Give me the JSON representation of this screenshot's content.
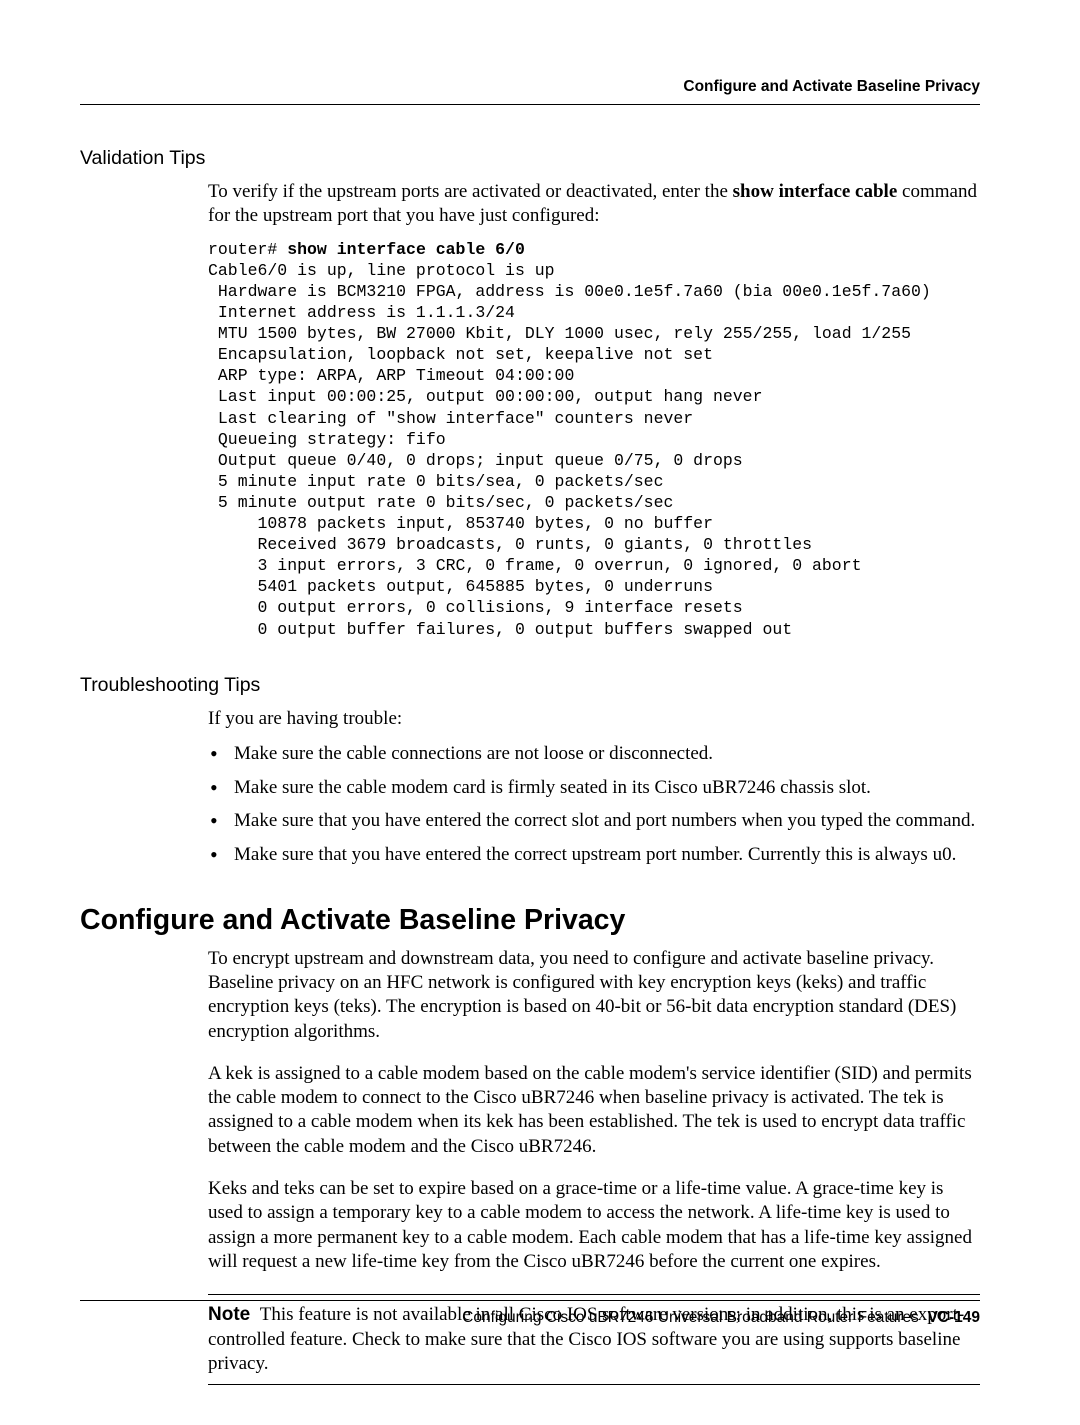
{
  "header": {
    "running_title": "Configure and Activate Baseline Privacy"
  },
  "validation": {
    "heading": "Validation Tips",
    "intro_pre": "To verify if the upstream ports are activated or deactivated, enter the ",
    "intro_cmd": "show interface cable",
    "intro_post": " command for the upstream port that you have just configured:",
    "code_prompt": "router# ",
    "code_cmd": "show interface cable 6/0",
    "code_body": "Cable6/0 is up, line protocol is up\n Hardware is BCM3210 FPGA, address is 00e0.1e5f.7a60 (bia 00e0.1e5f.7a60)\n Internet address is 1.1.1.3/24\n MTU 1500 bytes, BW 27000 Kbit, DLY 1000 usec, rely 255/255, load 1/255\n Encapsulation, loopback not set, keepalive not set\n ARP type: ARPA, ARP Timeout 04:00:00\n Last input 00:00:25, output 00:00:00, output hang never\n Last clearing of \"show interface\" counters never\n Queueing strategy: fifo\n Output queue 0/40, 0 drops; input queue 0/75, 0 drops\n 5 minute input rate 0 bits/sea, 0 packets/sec\n 5 minute output rate 0 bits/sec, 0 packets/sec\n     10878 packets input, 853740 bytes, 0 no buffer\n     Received 3679 broadcasts, 0 runts, 0 giants, 0 throttles\n     3 input errors, 3 CRC, 0 frame, 0 overrun, 0 ignored, 0 abort\n     5401 packets output, 645885 bytes, 0 underruns\n     0 output errors, 0 collisions, 9 interface resets\n     0 output buffer failures, 0 output buffers swapped out"
  },
  "troubleshooting": {
    "heading": "Troubleshooting Tips",
    "intro": "If you are having trouble:",
    "bullets": [
      "Make sure the cable connections are not loose or disconnected.",
      "Make sure the cable modem card is firmly seated in its Cisco uBR7246 chassis slot.",
      "Make sure that you have entered the correct slot and port numbers when you typed the command.",
      "Make sure that you have entered the correct upstream port number. Currently this is always u0."
    ]
  },
  "section": {
    "heading": "Configure and Activate Baseline Privacy",
    "p1": "To encrypt upstream and downstream data, you need to configure and activate baseline privacy. Baseline privacy on an HFC network is configured with key encryption keys (keks) and traffic encryption keys (teks). The encryption is based on 40-bit or 56-bit data encryption standard (DES) encryption algorithms.",
    "p2": "A kek is assigned to a cable modem based on the cable modem's service identifier (SID) and permits the cable modem to connect to the Cisco uBR7246 when baseline privacy is activated. The tek is assigned to a cable modem when its kek has been established. The tek is used to encrypt data traffic between the cable modem and the Cisco uBR7246.",
    "p3": "Keks and teks can be set to expire based on a grace-time or a life-time value. A grace-time key is used to assign a temporary key to a cable modem to access the network. A life-time key is used to assign a more permanent key to a cable modem. Each cable modem that has a life-time key assigned will request a new life-time key from the Cisco uBR7246 before the current one expires.",
    "note_label": "Note",
    "note_body": "This feature is not available in all Cisco IOS software versions; in addition, this is an export-controlled feature. Check to make sure that the Cisco IOS software you are using supports baseline privacy."
  },
  "footer": {
    "title": "Configuring Cisco uBR7246 Universal Broadband Router Features",
    "page": "VC-149"
  }
}
